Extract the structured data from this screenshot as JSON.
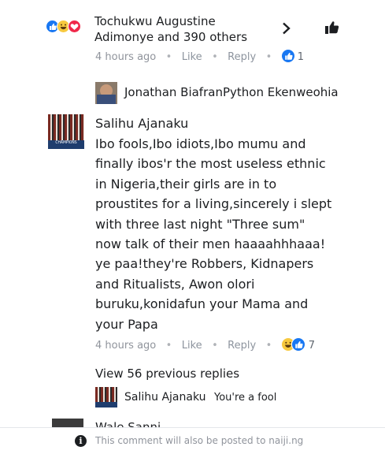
{
  "header": {
    "reactors_line1": "Tochukwu Augustine",
    "reactors_line2": "Adimonye and 390 others"
  },
  "comment1_meta": {
    "time": "4 hours ago",
    "like": "Like",
    "reply": "Reply",
    "reaction_count": "1"
  },
  "reply1": {
    "name": "Jonathan BiafranPython Ekenweohia"
  },
  "main_comment": {
    "author": "Salihu Ajanaku",
    "avatar_caption": "CHAMPIONS",
    "text_lines": [
      "Ibo fools,Ibo idiots,Ibo mumu and",
      "finally ibos'r the most useless ethnic",
      "in Nigeria,their girls are in to",
      "proustites for a living,sincerely i slept",
      "with three last night \"Three sum\"",
      "now talk of their men haaaahhhaaa!",
      "ye paa!they're Robbers, Kidnapers",
      "and Ritualists, Awon olori",
      "buruku,konidafun your Mama and",
      "your Papa"
    ],
    "time": "4 hours ago",
    "like": "Like",
    "reply": "Reply",
    "reaction_count": "7"
  },
  "view_previous": "View 56 previous replies",
  "reply2": {
    "name": "Salihu Ajanaku",
    "text": "You're a fool"
  },
  "partial_comment": {
    "name": "Wale Sanni"
  },
  "footer": {
    "notice": "This comment will also be posted to naijі.ng"
  },
  "colors": {
    "like_blue": "#1877f2",
    "love_red": "#f0284a",
    "haha_yellow": "#f7c93f",
    "muted": "#90949c"
  },
  "icons": [
    "like-reaction-icon",
    "haha-reaction-icon",
    "love-reaction-icon",
    "chevron-right-icon",
    "thumbs-up-icon",
    "info-icon"
  ]
}
